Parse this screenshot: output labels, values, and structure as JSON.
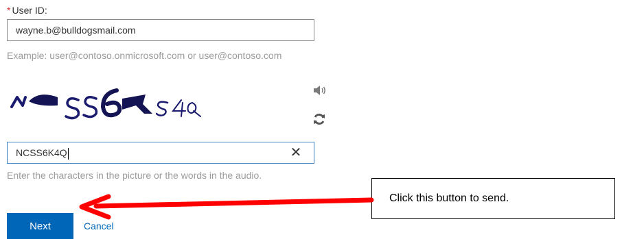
{
  "form": {
    "user_id_required_mark": "*",
    "user_id_label": "User ID:",
    "user_id_value": "wayne.b@bulldogsmail.com",
    "user_id_example": "Example: user@contoso.onmicrosoft.com or user@contoso.com",
    "captcha_image_text": "NCSS6K4Q",
    "captcha_input_value": "NCSS6K4Q",
    "captcha_hint": "Enter the characters in the picture or the words in the audio.",
    "clear_glyph": "✕",
    "next_label": "Next",
    "cancel_label": "Cancel"
  },
  "annotation": {
    "callout_text": "Click this button to send.",
    "arrow_color": "#ff0000"
  },
  "colors": {
    "accent": "#0067b8",
    "focus_border": "#3b7fc4",
    "hint_text": "#9b9b9b",
    "required": "#d13438"
  },
  "icons": {
    "audio": "speaker-icon",
    "refresh": "refresh-icon",
    "clear": "close-icon"
  }
}
